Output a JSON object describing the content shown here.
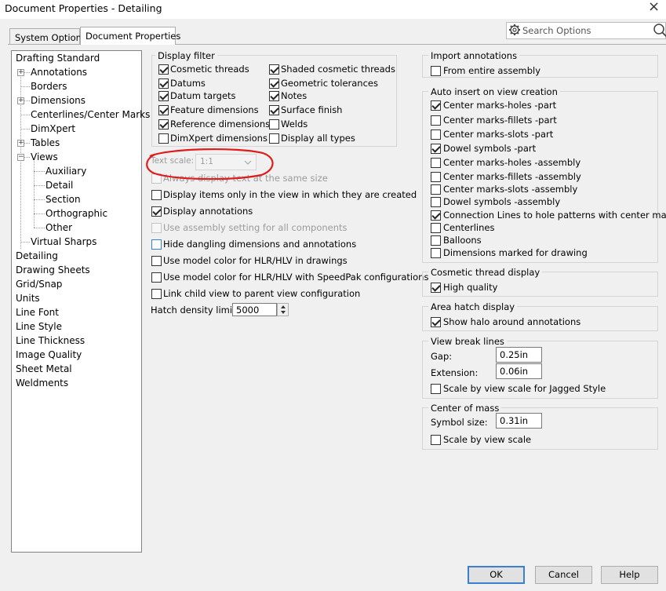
{
  "window": {
    "title": "Document Properties - Detailing",
    "close_glyph": "×"
  },
  "tabs": [
    {
      "label": "System Options"
    },
    {
      "label": "Document Properties"
    }
  ],
  "search": {
    "placeholder": "Search Options"
  },
  "tree": {
    "items": [
      {
        "label": "Drafting Standard"
      },
      {
        "label": "Annotations"
      },
      {
        "label": "Borders"
      },
      {
        "label": "Dimensions"
      },
      {
        "label": "Centerlines/Center Marks"
      },
      {
        "label": "DimXpert"
      },
      {
        "label": "Tables"
      },
      {
        "label": "Views"
      },
      {
        "label": "Auxiliary"
      },
      {
        "label": "Detail"
      },
      {
        "label": "Section"
      },
      {
        "label": "Orthographic"
      },
      {
        "label": "Other"
      },
      {
        "label": "Virtual Sharps"
      },
      {
        "label": "Detailing"
      },
      {
        "label": "Drawing Sheets"
      },
      {
        "label": "Grid/Snap"
      },
      {
        "label": "Units"
      },
      {
        "label": "Line Font"
      },
      {
        "label": "Line Style"
      },
      {
        "label": "Line Thickness"
      },
      {
        "label": "Image Quality"
      },
      {
        "label": "Sheet Metal"
      },
      {
        "label": "Weldments"
      }
    ]
  },
  "display_filter": {
    "title": "Display filter",
    "items": [
      {
        "label": "Cosmetic threads",
        "checked": true
      },
      {
        "label": "Shaded cosmetic threads",
        "checked": true
      },
      {
        "label": "Datums",
        "checked": true
      },
      {
        "label": "Geometric tolerances",
        "checked": true
      },
      {
        "label": "Datum targets",
        "checked": true
      },
      {
        "label": "Notes",
        "checked": true
      },
      {
        "label": "Feature dimensions",
        "checked": true
      },
      {
        "label": "Surface finish",
        "checked": true
      },
      {
        "label": "Reference dimensions",
        "checked": true
      },
      {
        "label": "Welds",
        "checked": false
      },
      {
        "label": "DimXpert dimensions",
        "checked": false
      },
      {
        "label": "Display all types",
        "checked": false
      }
    ]
  },
  "text_scale": {
    "label": "Text scale:",
    "value": "1:1"
  },
  "options": [
    {
      "label": "Always display text at the same size",
      "checked": false,
      "disabled": true
    },
    {
      "label": "Display items only in the view in which they are created",
      "checked": false
    },
    {
      "label": "Display annotations",
      "checked": true
    },
    {
      "label": "Use assembly setting for all components",
      "checked": false,
      "disabled": true
    },
    {
      "label": "Hide dangling dimensions and annotations",
      "checked": false
    },
    {
      "label": "Use model color for HLR/HLV in drawings",
      "checked": false
    },
    {
      "label": "Use model color for HLR/HLV with SpeedPak configurations",
      "checked": false
    },
    {
      "label": "Link child view to parent view configuration",
      "checked": false
    }
  ],
  "hatch": {
    "label": "Hatch density limit:",
    "value": "5000"
  },
  "import_annotations": {
    "title": "Import annotations",
    "items": [
      {
        "label": "From entire assembly",
        "checked": false
      }
    ]
  },
  "auto_insert": {
    "title": "Auto insert on view creation",
    "items": [
      {
        "label": "Center marks-holes -part",
        "checked": true
      },
      {
        "label": "Center marks-fillets -part",
        "checked": false
      },
      {
        "label": "Center marks-slots  -part",
        "checked": false
      },
      {
        "label": "Dowel symbols -part",
        "checked": true
      },
      {
        "label": "Center marks-holes -assembly",
        "checked": false
      },
      {
        "label": "Center marks-fillets -assembly",
        "checked": false
      },
      {
        "label": "Center marks-slots  -assembly",
        "checked": false
      },
      {
        "label": "Dowel symbols -assembly",
        "checked": false
      },
      {
        "label": "Connection Lines to hole patterns with center marks",
        "checked": true
      },
      {
        "label": "Centerlines",
        "checked": false
      },
      {
        "label": "Balloons",
        "checked": false
      },
      {
        "label": "Dimensions marked for drawing",
        "checked": false
      }
    ]
  },
  "cosmetic_thread": {
    "title": "Cosmetic thread display",
    "items": [
      {
        "label": "High quality",
        "checked": true
      }
    ]
  },
  "area_hatch": {
    "title": "Area hatch display",
    "items": [
      {
        "label": "Show halo around annotations",
        "checked": true
      }
    ]
  },
  "view_break": {
    "title": "View break lines",
    "gap_label": "Gap:",
    "gap_value": "0.25in",
    "ext_label": "Extension:",
    "ext_value": "0.06in",
    "scale_label": "Scale by view scale for Jagged Style",
    "scale_checked": false
  },
  "center_mass": {
    "title": "Center of mass",
    "size_label": "Symbol size:",
    "size_value": "0.31in",
    "scale_label": "Scale by view scale",
    "scale_checked": false
  },
  "buttons": {
    "ok": "OK",
    "cancel": "Cancel",
    "help": "Help"
  },
  "colors": {
    "annotation_red": "#e01b1b",
    "focus_blue": "#3b7fd1"
  },
  "icons": {
    "search": "magnifier-icon",
    "options": "gear-icon"
  }
}
